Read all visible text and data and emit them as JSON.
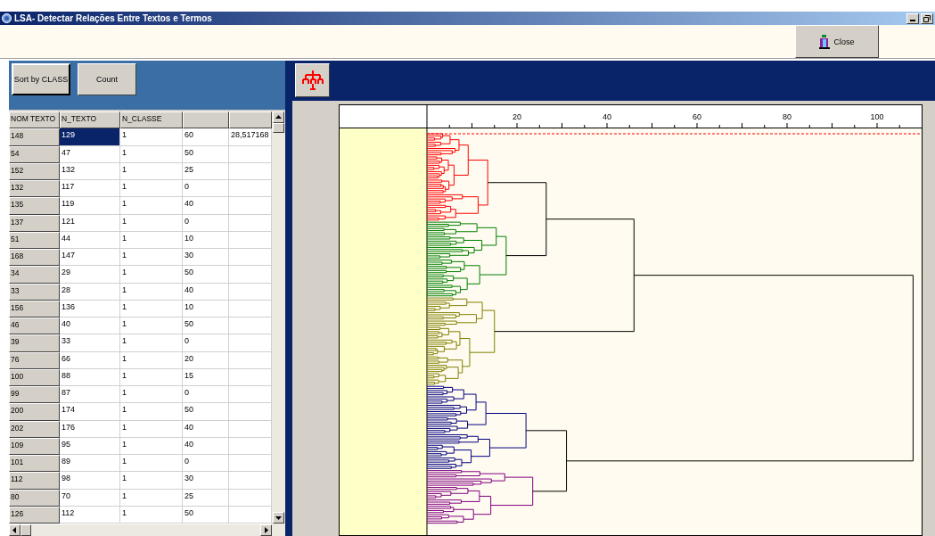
{
  "window": {
    "title": "LSA- Detectar Relações Entre Textos e Termos"
  },
  "toolbar": {
    "close_button": "Close"
  },
  "left_panel": {
    "buttons": [
      "Sort by CLASS",
      "Count"
    ]
  },
  "table": {
    "columns": [
      "NOM TEXTO",
      "N_TEXTO",
      "N_CLASSE"
    ],
    "rows": [
      {
        "cells": [
          "148",
          "129",
          "1",
          "60",
          "28,517168"
        ],
        "selected": true
      },
      {
        "cells": [
          "54",
          "47",
          "1",
          "50"
        ],
        "selected": false
      },
      {
        "cells": [
          "152",
          "132",
          "1",
          "25"
        ],
        "selected": false
      },
      {
        "cells": [
          "132",
          "117",
          "1",
          "0"
        ],
        "selected": false
      },
      {
        "cells": [
          "135",
          "119",
          "1",
          "40"
        ],
        "selected": false
      },
      {
        "cells": [
          "137",
          "121",
          "1",
          "0"
        ],
        "selected": false
      },
      {
        "cells": [
          "51",
          "44",
          "1",
          "10"
        ],
        "selected": false
      },
      {
        "cells": [
          "168",
          "147",
          "1",
          "30"
        ],
        "selected": false
      },
      {
        "cells": [
          "34",
          "29",
          "1",
          "50"
        ],
        "selected": false
      },
      {
        "cells": [
          "33",
          "28",
          "1",
          "40"
        ],
        "selected": false
      },
      {
        "cells": [
          "156",
          "136",
          "1",
          "10"
        ],
        "selected": false
      },
      {
        "cells": [
          "46",
          "40",
          "1",
          "50"
        ],
        "selected": false
      },
      {
        "cells": [
          "39",
          "33",
          "1",
          "0"
        ],
        "selected": false
      },
      {
        "cells": [
          "76",
          "66",
          "1",
          "20"
        ],
        "selected": false
      },
      {
        "cells": [
          "100",
          "88",
          "1",
          "15"
        ],
        "selected": false
      },
      {
        "cells": [
          "99",
          "87",
          "1",
          "0"
        ],
        "selected": false
      },
      {
        "cells": [
          "200",
          "174",
          "1",
          "50"
        ],
        "selected": false
      },
      {
        "cells": [
          "202",
          "176",
          "1",
          "40"
        ],
        "selected": false
      },
      {
        "cells": [
          "109",
          "95",
          "1",
          "40"
        ],
        "selected": false
      },
      {
        "cells": [
          "101",
          "89",
          "1",
          "0"
        ],
        "selected": false
      },
      {
        "cells": [
          "112",
          "98",
          "1",
          "30"
        ],
        "selected": false
      },
      {
        "cells": [
          "80",
          "70",
          "1",
          "25"
        ],
        "selected": false
      },
      {
        "cells": [
          "126",
          "112",
          "1",
          "50"
        ],
        "selected": false
      }
    ]
  },
  "dendrogram": {
    "axis_ticks": [
      "20",
      "40",
      "60",
      "80",
      "100"
    ],
    "clusters": [
      {
        "color": "#ff0000"
      },
      {
        "color": "#008000"
      },
      {
        "color": "#808000"
      },
      {
        "color": "#000080"
      },
      {
        "color": "#800080"
      }
    ]
  }
}
